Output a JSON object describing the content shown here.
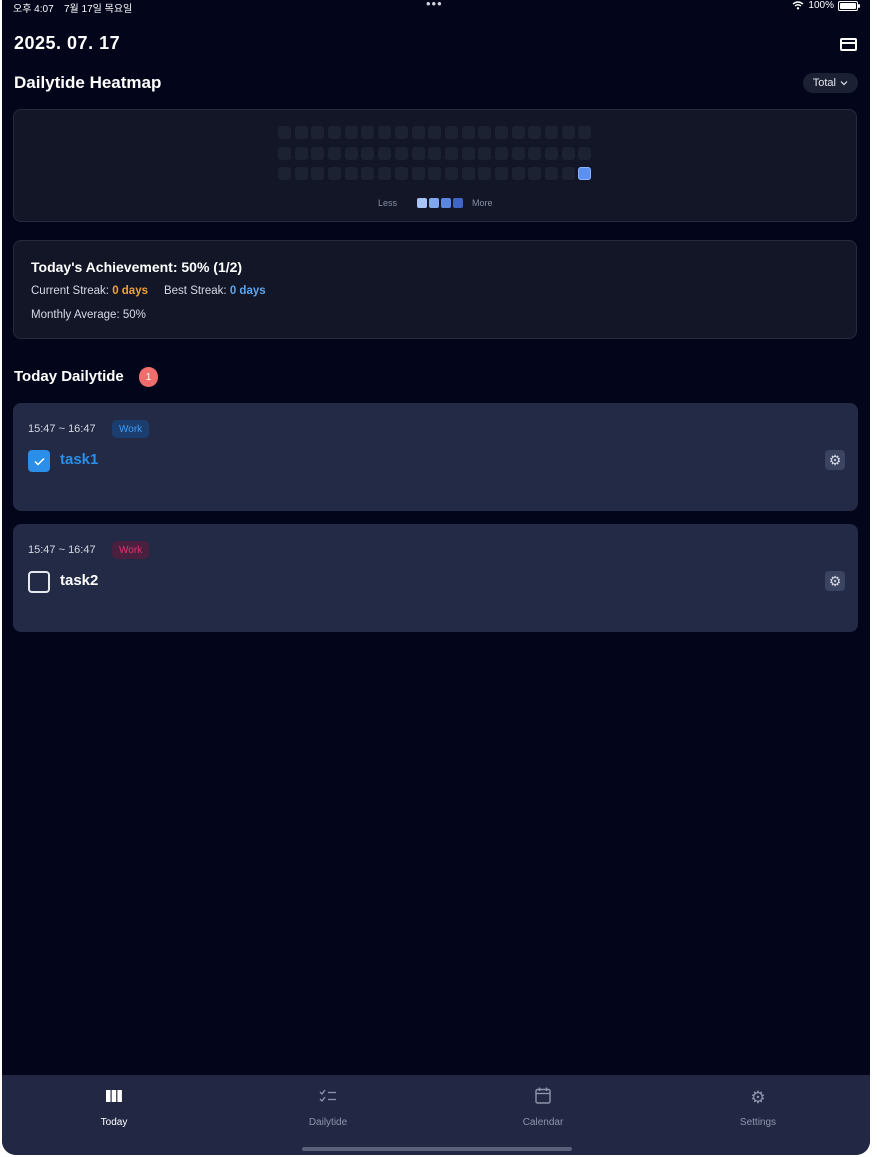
{
  "status_bar": {
    "time": "오후 4:07",
    "date": "7월 17일 목요일",
    "battery": "100%"
  },
  "header": {
    "date": "2025. 07. 17"
  },
  "heatmap": {
    "title": "Dailytide Heatmap",
    "filter": "Total",
    "legend_less": "Less",
    "legend_more": "More",
    "legend_colors": [
      "#a8c4f5",
      "#7ea7ef",
      "#5a86df",
      "#3f66c4"
    ],
    "rows": 3,
    "cols": 19,
    "active_cell": [
      2,
      18
    ],
    "active_color": "#5b8ff0"
  },
  "achievement": {
    "title": "Today's Achievement: 50% (1/2)",
    "current_streak_label": "Current Streak:",
    "current_streak_value": "0 days",
    "best_streak_label": "Best Streak:",
    "best_streak_value": "0 days",
    "monthly_average": "Monthly Average: 50%"
  },
  "today": {
    "title": "Today Dailytide",
    "count": "1",
    "tasks": [
      {
        "time": "15:47 ~ 16:47",
        "tag": "Work",
        "name": "task1",
        "checked": true
      },
      {
        "time": "15:47 ~ 16:47",
        "tag": "Work",
        "name": "task2",
        "checked": false
      }
    ]
  },
  "tabs": [
    {
      "label": "Today",
      "icon": "today-icon",
      "active": true
    },
    {
      "label": "Dailytide",
      "icon": "checklist-icon",
      "active": false
    },
    {
      "label": "Calendar",
      "icon": "calendar-icon",
      "active": false
    },
    {
      "label": "Settings",
      "icon": "gear-icon",
      "active": false
    }
  ]
}
